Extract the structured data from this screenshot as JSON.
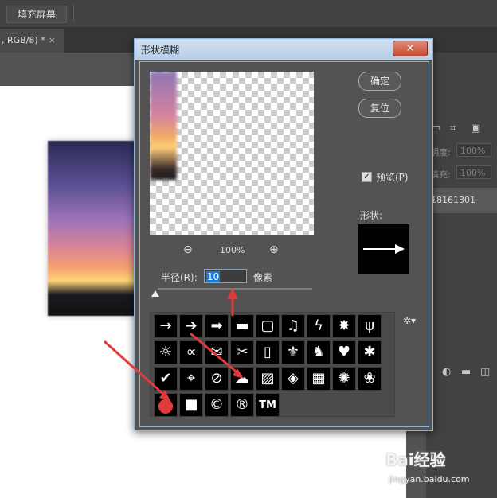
{
  "options_bar": {
    "fill_screen_label": "填充屏幕"
  },
  "document_tab": {
    "label": ", RGB/8) *",
    "close": "×"
  },
  "right_panel": {
    "opacity_label": "明度:",
    "opacity_value": "100%",
    "fill_label": "填充:",
    "fill_value": "100%",
    "layer_name": "18161301"
  },
  "dialog": {
    "title": "形状模糊",
    "close": "×",
    "ok_label": "确定",
    "reset_label": "复位",
    "preview_label": "预览(P)",
    "shape_label": "形状:",
    "zoom_out": "⊖",
    "zoom_level": "100%",
    "zoom_in": "⊕",
    "radius_label": "半径(R):",
    "radius_value": "10",
    "radius_unit": "像素",
    "radius_fraction": 0.0,
    "gear": "✲▾"
  },
  "shapes": [
    {
      "name": "arrow-thin",
      "glyph": "→"
    },
    {
      "name": "arrow-bold",
      "glyph": "➔"
    },
    {
      "name": "arrow-fat",
      "glyph": "➡"
    },
    {
      "name": "banner",
      "glyph": "▬"
    },
    {
      "name": "frame",
      "glyph": "▢"
    },
    {
      "name": "music-note",
      "glyph": "♫"
    },
    {
      "name": "lightning",
      "glyph": "ϟ"
    },
    {
      "name": "starburst",
      "glyph": "✸"
    },
    {
      "name": "grass",
      "glyph": "ψ"
    },
    {
      "name": "lightbulb",
      "glyph": "☼"
    },
    {
      "name": "bone",
      "glyph": "∝"
    },
    {
      "name": "envelope",
      "glyph": "✉"
    },
    {
      "name": "scissors",
      "glyph": "✂"
    },
    {
      "name": "rectangle-frame",
      "glyph": "▯"
    },
    {
      "name": "fleur-de-lis",
      "glyph": "⚜"
    },
    {
      "name": "puzzle-piece",
      "glyph": "♞"
    },
    {
      "name": "heart",
      "glyph": "♥"
    },
    {
      "name": "splat",
      "glyph": "✱"
    },
    {
      "name": "checkmark",
      "glyph": "✔"
    },
    {
      "name": "target",
      "glyph": "⌖"
    },
    {
      "name": "no-symbol",
      "glyph": "⊘"
    },
    {
      "name": "speech-bubble",
      "glyph": "☁"
    },
    {
      "name": "diagonal-lines",
      "glyph": "▨"
    },
    {
      "name": "diamond-pattern",
      "glyph": "◈"
    },
    {
      "name": "grid",
      "glyph": "▦"
    },
    {
      "name": "burst",
      "glyph": "✺"
    },
    {
      "name": "paw-print",
      "glyph": "❀"
    },
    {
      "name": "circle",
      "glyph": "●"
    },
    {
      "name": "square",
      "glyph": "■"
    },
    {
      "name": "copyright",
      "glyph": "©"
    },
    {
      "name": "registered",
      "glyph": "®"
    },
    {
      "name": "trademark",
      "glyph": "TM"
    }
  ],
  "watermark": {
    "main": "Bai经验",
    "sub": "jingyan.baidu.com"
  },
  "colors": {
    "annotation_red": "#e03a3a",
    "dialog_bg": "#535353",
    "titlebar": "#bed3ea"
  }
}
